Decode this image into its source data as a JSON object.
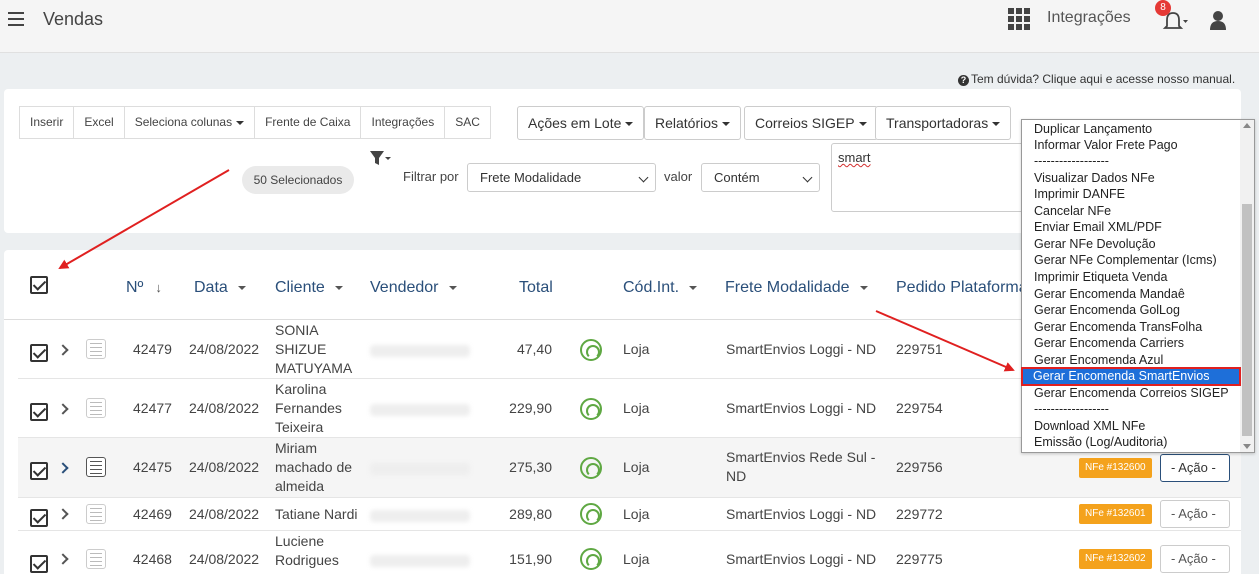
{
  "header": {
    "title": "Vendas",
    "integracoes": "Integrações",
    "notification_count": "8"
  },
  "help_text": "Tem dúvida? Clique aqui e acesse nosso manual.",
  "toolbar": {
    "group": [
      "Inserir",
      "Excel",
      "Seleciona colunas",
      "Frente de Caixa",
      "Integrações",
      "SAC"
    ],
    "acoes_lote": "Ações em Lote",
    "relatorios": "Relatórios",
    "correios": "Correios SIGEP",
    "transportadoras": "Transportadoras"
  },
  "filter": {
    "selected_count": "50 Selecionados",
    "filtrar_label": "Filtrar por",
    "field_value": "Frete Modalidade",
    "valor_label": "valor",
    "operator_value": "Contém",
    "search_value": "smart"
  },
  "table": {
    "headers": {
      "num": "Nº",
      "data": "Data",
      "cliente": "Cliente",
      "vendedor": "Vendedor",
      "total": "Total",
      "cod_int": "Cód.Int.",
      "frete": "Frete Modalidade",
      "pedido": "Pedido Plataforma"
    },
    "rows": [
      {
        "num": "42479",
        "data": "24/08/2022",
        "cliente": "SONIA SHIZUE MATUYAMA",
        "total": "47,40",
        "cod": "Loja",
        "frete": "SmartEnvios Loggi - ND",
        "pedido": "229751",
        "nfe": "",
        "acao": ""
      },
      {
        "num": "42477",
        "data": "24/08/2022",
        "cliente": "Karolina Fernandes Teixeira",
        "total": "229,90",
        "cod": "Loja",
        "frete": "SmartEnvios Loggi - ND",
        "pedido": "229754",
        "nfe": "",
        "acao": ""
      },
      {
        "num": "42475",
        "data": "24/08/2022",
        "cliente": "Miriam machado de almeida",
        "total": "275,30",
        "cod": "Loja",
        "frete": "SmartEnvios Rede Sul - ND",
        "pedido": "229756",
        "nfe": "NFe #132600",
        "acao": "- Ação -"
      },
      {
        "num": "42469",
        "data": "24/08/2022",
        "cliente": "Tatiane Nardi",
        "total": "289,80",
        "cod": "Loja",
        "frete": "SmartEnvios Loggi - ND",
        "pedido": "229772",
        "nfe": "NFe #132601",
        "acao": "- Ação -"
      },
      {
        "num": "42468",
        "data": "24/08/2022",
        "cliente": "Luciene Rodrigues",
        "total": "151,90",
        "cod": "Loja",
        "frete": "SmartEnvios Loggi - ND",
        "pedido": "229775",
        "nfe": "NFe #132602",
        "acao": "- Ação -"
      }
    ]
  },
  "dropdown": {
    "items": [
      "Duplicar Lançamento",
      "Informar Valor Frete Pago",
      "------------------",
      "Visualizar Dados NFe",
      "Imprimir DANFE",
      "Cancelar NFe",
      "Enviar Email XML/PDF",
      "Gerar NFe Devolução",
      "Gerar NFe Complementar (Icms)",
      "Imprimir Etiqueta Venda",
      "Gerar Encomenda Mandaê",
      "Gerar Encomenda GolLog",
      "Gerar Encomenda TransFolha",
      "Gerar Encomenda Carriers",
      "Gerar Encomenda Azul",
      "Gerar Encomenda SmartEnvios",
      "Gerar Encomenda Correios SIGEP",
      "------------------",
      "Download XML NFe",
      "Emissão (Log/Auditoria)"
    ],
    "selected_index": 15,
    "highlight_color": "#1e6fd9",
    "annotation_color": "#e02020"
  }
}
